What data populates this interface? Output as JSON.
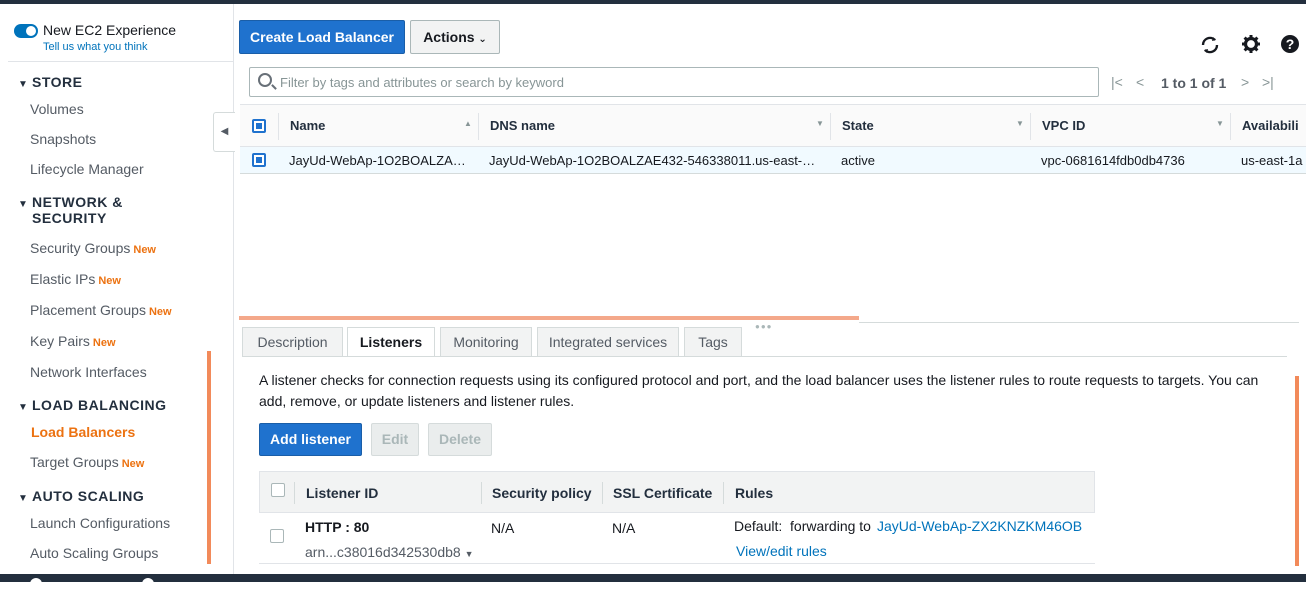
{
  "sidebar": {
    "experience_title": "New EC2 Experience",
    "experience_link": "Tell us what you think",
    "sections": {
      "store": "STORE",
      "network_line1": "NETWORK &",
      "network_line2": "SECURITY",
      "load_balancing": "LOAD BALANCING",
      "auto_scaling": "AUTO SCALING"
    },
    "items": {
      "volumes": "Volumes",
      "snapshots": "Snapshots",
      "lifecycle": "Lifecycle Manager",
      "security_groups": "Security Groups",
      "elastic_ips": "Elastic IPs",
      "placement_groups": "Placement Groups",
      "key_pairs": "Key Pairs",
      "network_interfaces": "Network Interfaces",
      "load_balancers": "Load Balancers",
      "target_groups": "Target Groups",
      "launch_configurations": "Launch Configurations",
      "auto_scaling_groups": "Auto Scaling Groups"
    },
    "new_badge": "New"
  },
  "toolbar": {
    "create_label": "Create Load Balancer",
    "actions_label": "Actions"
  },
  "search": {
    "placeholder": "Filter by tags and attributes or search by keyword"
  },
  "pager": {
    "text": "1 to 1 of 1"
  },
  "table": {
    "headers": {
      "name": "Name",
      "dns": "DNS name",
      "state": "State",
      "vpc": "VPC ID",
      "az": "Availabili"
    },
    "row": {
      "name": "JayUd-WebAp-1O2BOALZA…",
      "dns": "JayUd-WebAp-1O2BOALZAE432-546338011.us-east-…",
      "state": "active",
      "vpc": "vpc-0681614fdb0db4736",
      "az": "us-east-1a"
    }
  },
  "tabs": {
    "description": "Description",
    "listeners": "Listeners",
    "monitoring": "Monitoring",
    "integrated": "Integrated services",
    "tags": "Tags"
  },
  "listeners": {
    "description": "A listener checks for connection requests using its configured protocol and port, and the load balancer uses the listener rules to route requests to targets. You can add, remove, or update listeners and listener rules.",
    "add_label": "Add listener",
    "edit_label": "Edit",
    "delete_label": "Delete",
    "headers": {
      "id": "Listener ID",
      "policy": "Security policy",
      "ssl": "SSL Certificate",
      "rules": "Rules"
    },
    "row": {
      "protocol": "HTTP : 80",
      "arn": "arn...c38016d342530db8",
      "policy": "N/A",
      "ssl": "N/A",
      "rule_prefix": "Default:  forwarding to",
      "rule_target": "JayUd-WebAp-ZX2KNZKM46OB",
      "view_edit": "View/edit rules"
    }
  },
  "colors": {
    "primary": "#1f72ce",
    "accent_orange": "#ec7211",
    "link": "#0073bb"
  }
}
